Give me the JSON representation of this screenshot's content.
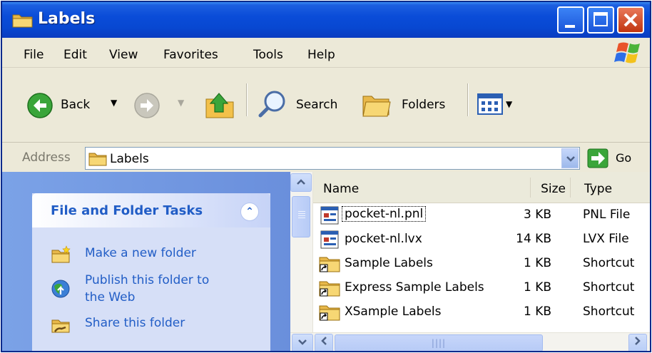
{
  "window": {
    "title": "Labels"
  },
  "menu": [
    "File",
    "Edit",
    "View",
    "Favorites",
    "Tools",
    "Help"
  ],
  "toolbar": {
    "back_label": "Back",
    "search_label": "Search",
    "folders_label": "Folders"
  },
  "address": {
    "label": "Address",
    "value": "Labels",
    "go_label": "Go"
  },
  "tasks": {
    "title": "File and Folder Tasks",
    "links": [
      "Make a new folder",
      "Publish this folder to",
      "the Web",
      "Share this folder"
    ]
  },
  "columns": {
    "name": "Name",
    "size": "Size",
    "type": "Type"
  },
  "files": [
    {
      "name": "pocket-nl.pnl",
      "size": "3 KB",
      "type": "PNL File",
      "icon": "pnl-file-icon"
    },
    {
      "name": "pocket-nl.lvx",
      "size": "14 KB",
      "type": "LVX File",
      "icon": "lvx-file-icon"
    },
    {
      "name": "Sample Labels",
      "size": "1 KB",
      "type": "Shortcut",
      "icon": "folder-shortcut-icon"
    },
    {
      "name": "Express Sample Labels",
      "size": "1 KB",
      "type": "Shortcut",
      "icon": "folder-shortcut-icon"
    },
    {
      "name": "XSample Labels",
      "size": "1 KB",
      "type": "Shortcut",
      "icon": "folder-shortcut-icon"
    }
  ],
  "colors": {
    "title_blue": "#0848d2",
    "link_blue": "#215dc6",
    "chrome": "#ece9d8"
  }
}
